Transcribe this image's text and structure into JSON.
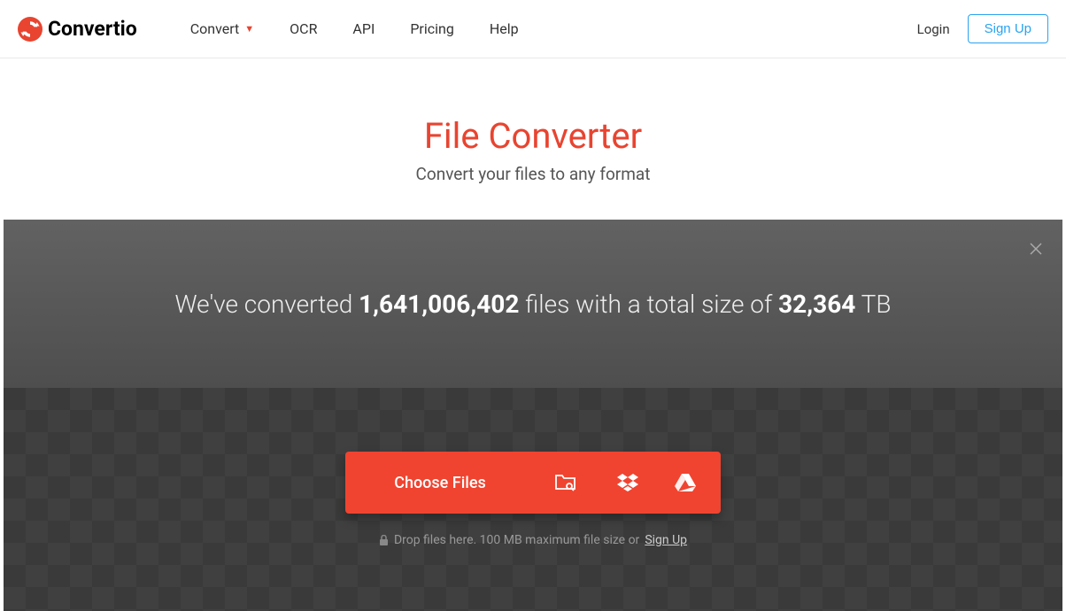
{
  "logo": {
    "text": "Convertio"
  },
  "nav": {
    "convert": "Convert",
    "ocr": "OCR",
    "api": "API",
    "pricing": "Pricing",
    "help": "Help"
  },
  "auth": {
    "login": "Login",
    "signup": "Sign Up"
  },
  "hero": {
    "title": "File Converter",
    "subtitle": "Convert your files to any format"
  },
  "stats": {
    "pre": "We've converted ",
    "files": "1,641,006,402",
    "mid": " files with a total size of ",
    "size": "32,364",
    "unit": " TB"
  },
  "uploader": {
    "choose": "Choose Files",
    "hint_pre": "Drop files here. 100 MB maximum file size or ",
    "hint_link": "Sign Up"
  }
}
